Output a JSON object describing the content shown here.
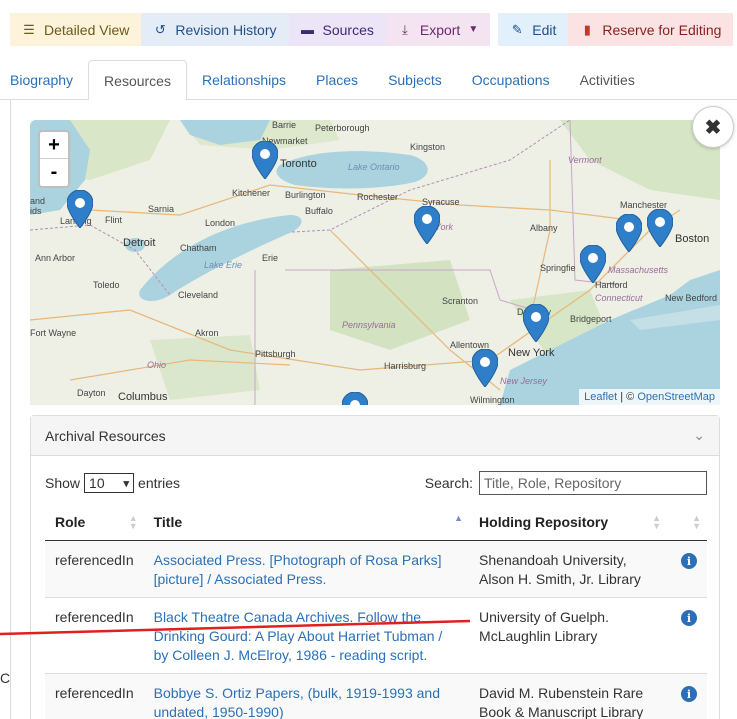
{
  "toolbar": {
    "detailed_view": "Detailed View",
    "revision_history": "Revision History",
    "sources": "Sources",
    "export": "Export",
    "edit": "Edit",
    "reserve": "Reserve for Editing"
  },
  "tabs": [
    {
      "label": "Biography"
    },
    {
      "label": "Resources"
    },
    {
      "label": "Relationships"
    },
    {
      "label": "Places"
    },
    {
      "label": "Subjects"
    },
    {
      "label": "Occupations"
    },
    {
      "label": "Activities"
    }
  ],
  "map": {
    "zoom_in": "+",
    "zoom_out": "-",
    "close": "✖",
    "attribution_leaflet": "Leaflet",
    "attribution_sep": " | © ",
    "attribution_osm": "OpenStreetMap",
    "labels": {
      "barrie": "Barrie",
      "peterborough": "Peterborough",
      "newmarket": "Newmarket",
      "toronto": "Toronto",
      "kingston": "Kingston",
      "lake_ontario": "Lake Ontario",
      "vermont": "Vermont",
      "kitchener": "Kitchener",
      "burlington": "Burlington",
      "rochester": "Rochester",
      "syracuse": "Syracuse",
      "buffalo": "Buffalo",
      "manchester": "Manchester",
      "and": "and",
      "ids": "ids",
      "sarnia": "Sarnia",
      "lansing": "Lansing",
      "flint": "Flint",
      "london": "London",
      "york": "York",
      "albany": "Albany",
      "boston": "Boston",
      "detroit": "Detroit",
      "chatham": "Chatham",
      "erie": "Erie",
      "ann_arbor": "Ann Arbor",
      "lake_erie": "Lake Erie",
      "springfield": "Springfie",
      "massachusetts": "Massachusetts",
      "toledo": "Toledo",
      "hartford": "Hartford",
      "cleveland": "Cleveland",
      "scranton": "Scranton",
      "connecticut": "Connecticut",
      "new_bedford": "New Bedford",
      "danbury": "Danbury",
      "bridgeport": "Bridgeport",
      "fort_wayne": "Fort Wayne",
      "akron": "Akron",
      "pennsylvania": "Pennsylvania",
      "allentown": "Allentown",
      "new_york": "New York",
      "pittsburgh": "Pittsburgh",
      "ohio": "Ohio",
      "harrisburg": "Harrisburg",
      "new_jersey": "New Jersey",
      "dayton": "Dayton",
      "columbus": "Columbus",
      "wilmington": "Wilmington"
    }
  },
  "archival": {
    "heading": "Archival Resources",
    "show": "Show",
    "entries_value": "10",
    "entries": "entries",
    "search_label": "Search:",
    "search_placeholder": "Title, Role, Repository",
    "columns": {
      "role": "Role",
      "title": "Title",
      "repository": "Holding Repository"
    },
    "rows": [
      {
        "role": "referencedIn",
        "title": "Associated Press. [Photograph of Rosa Parks] [picture] / Associated Press.",
        "repository": "Shenandoah University, Alson H. Smith, Jr. Library"
      },
      {
        "role": "referencedIn",
        "title": "Black Theatre Canada Archives. Follow the Drinking Gourd: A Play About Harriet Tubman / by Colleen J. McElroy, 1986 - reading script.",
        "repository": "University of Guelph. McLaughlin Library"
      },
      {
        "role": "referencedIn",
        "title": "Bobbye S. Ortiz Papers, (bulk, 1919-1993 and undated, 1950-1990)",
        "repository": "David M. Rubenstein Rare Book & Manuscript Library"
      }
    ]
  },
  "fragments": {
    "left_edge": "C"
  }
}
